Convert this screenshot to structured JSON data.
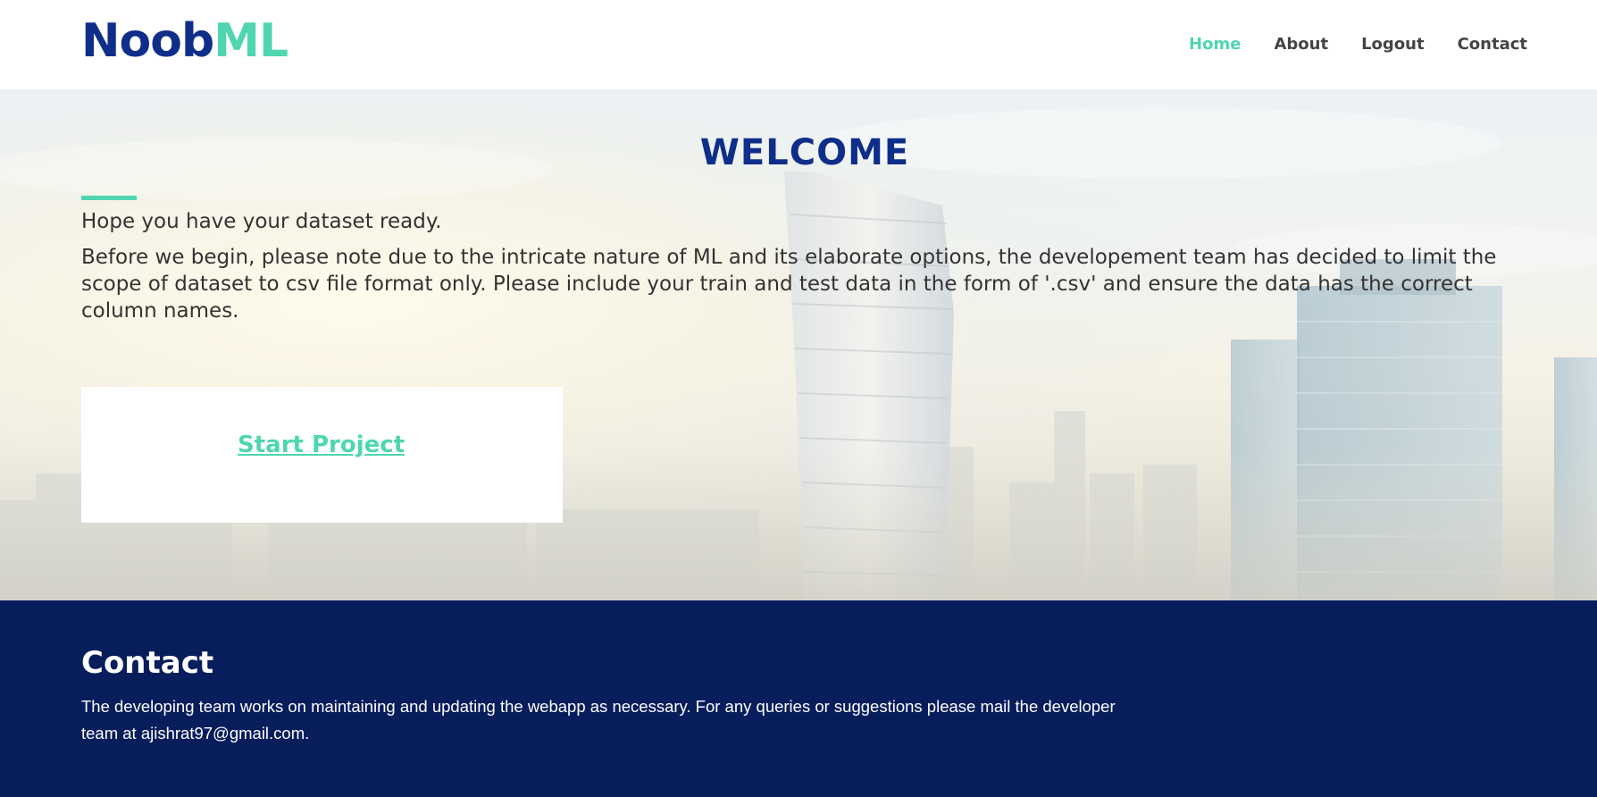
{
  "header": {
    "logo_part1": "Noob",
    "logo_part2": "ML",
    "nav": [
      {
        "label": "Home",
        "active": true
      },
      {
        "label": "About",
        "active": false
      },
      {
        "label": "Logout",
        "active": false
      },
      {
        "label": "Contact",
        "active": false
      }
    ]
  },
  "hero": {
    "title": "WELCOME",
    "lead": "Hope you have your dataset ready.",
    "note": "Before we begin, please note due to the intricate nature of ML and its elaborate options, the developement team has decided to limit the scope of dataset to csv file format only. Please include your train and test data in the form of '.csv' and ensure the data has the correct column names.",
    "cta_label": "Start Project"
  },
  "footer": {
    "title": "Contact",
    "text": "The developing team works on maintaining and updating the webapp as necessary. For any queries or suggestions please mail the developer team at ajishrat97@gmail.com."
  },
  "colors": {
    "brand_dark": "#0f2e8a",
    "brand_accent": "#4fd6b0",
    "footer_bg": "#071d5c"
  }
}
